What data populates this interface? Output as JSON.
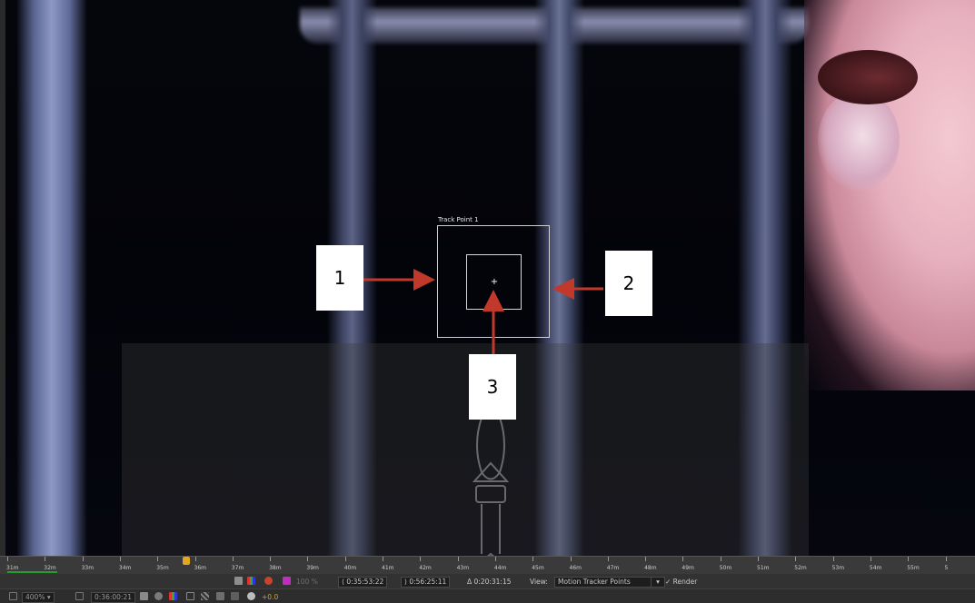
{
  "tracker": {
    "name": "Track Point 1"
  },
  "callouts": [
    "1",
    "2",
    "3"
  ],
  "ruler": {
    "ticks": [
      "31m",
      "32m",
      "33m",
      "34m",
      "35m",
      "36m",
      "37m",
      "38m",
      "39m",
      "40m",
      "41m",
      "42m",
      "43m",
      "44m",
      "45m",
      "46m",
      "47m",
      "48m",
      "49m",
      "50m",
      "51m",
      "52m",
      "53m",
      "54m",
      "55m",
      "5"
    ]
  },
  "viewer_controls": {
    "exposure": "100 %",
    "time_start": "0:35:53:22",
    "time_end": "0:56:25:11",
    "time_duration": "Δ 0:20:31:15",
    "view_label": "View:",
    "view_value": "Motion Tracker Points",
    "render_label": "Render"
  },
  "footer": {
    "zoom": "400%",
    "timecode": "0:36:00:21",
    "exposure_value": "+0.0"
  },
  "colors": {
    "accent_orange": "#e5a51c",
    "magenta": "#c02cbf",
    "arrow_red": "#c0392b"
  }
}
